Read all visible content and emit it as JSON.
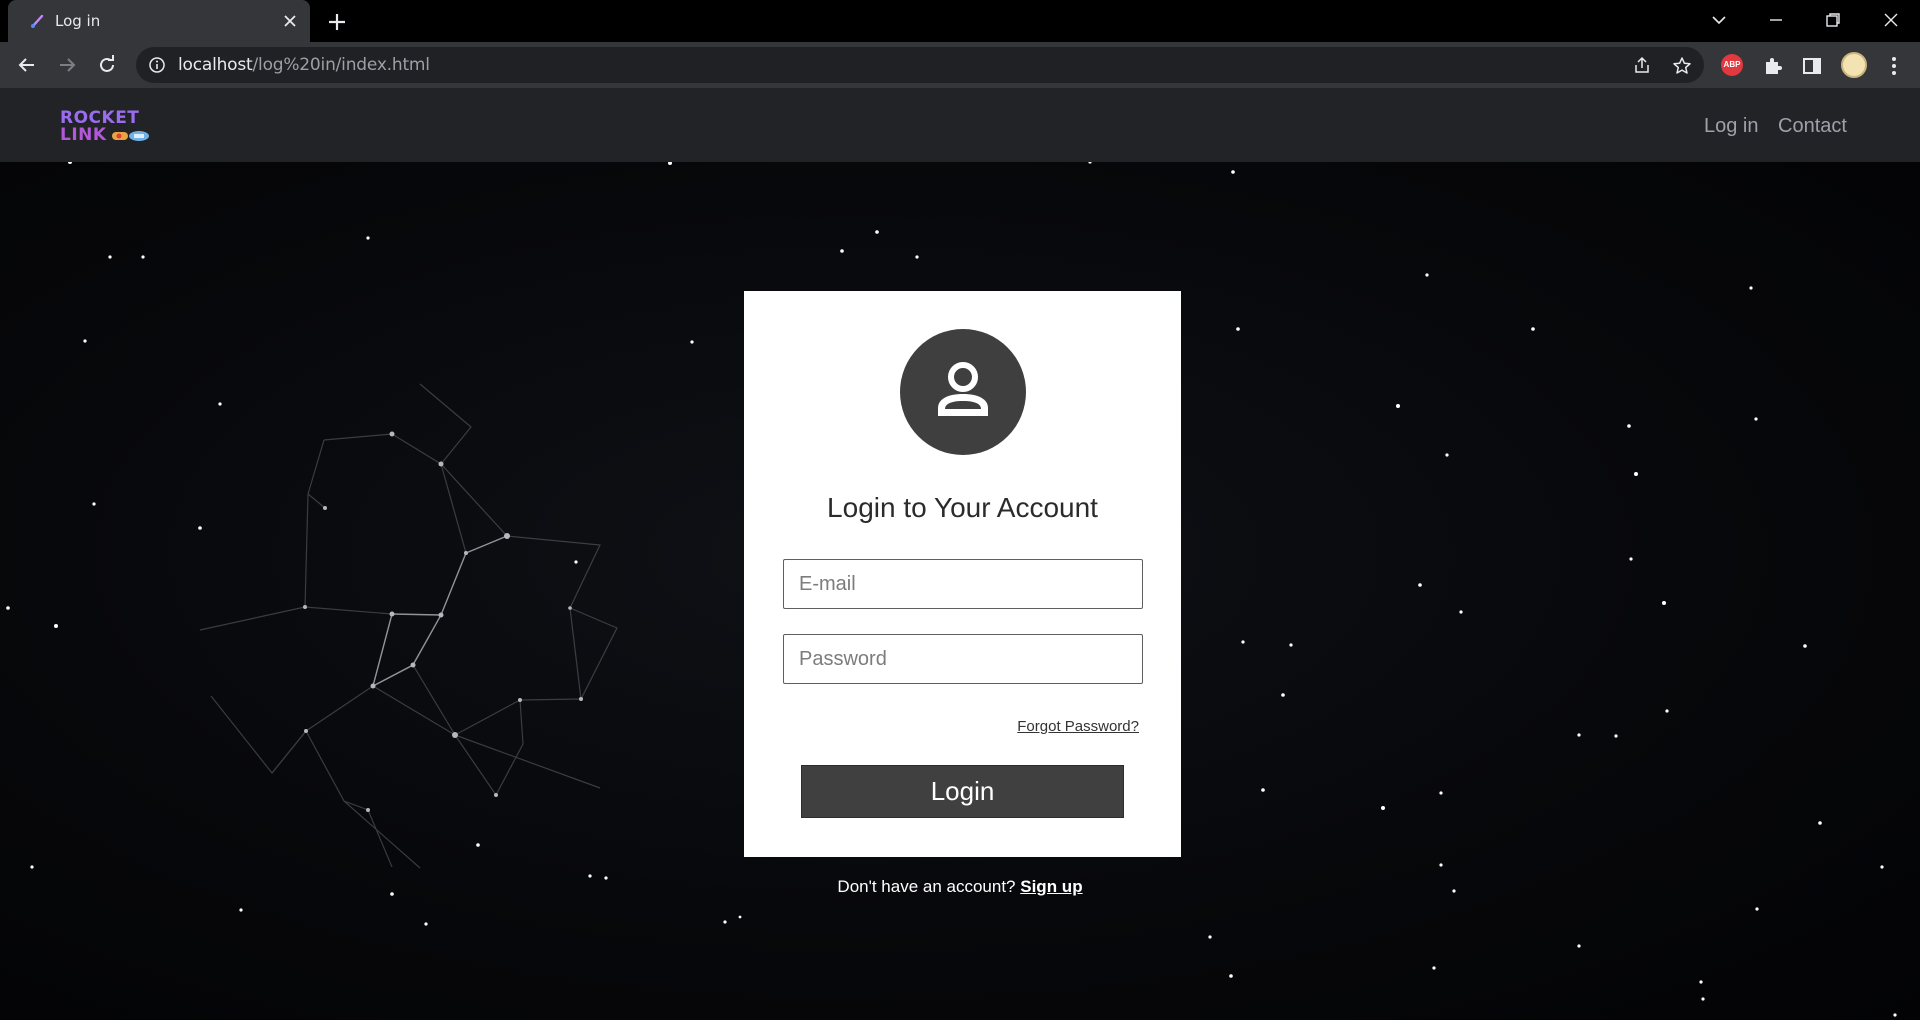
{
  "browser": {
    "tab_title": "Log in",
    "url_host": "localhost",
    "url_path": "/log%20in/index.html",
    "abp_label": "ABP"
  },
  "site": {
    "logo_line1": "ROCKET",
    "logo_line2": "LINK",
    "nav": {
      "login": "Log in",
      "contact": "Contact"
    }
  },
  "login_card": {
    "title": "Login to Your Account",
    "email_placeholder": "E-mail",
    "password_placeholder": "Password",
    "forgot_label": "Forgot Password?",
    "submit_label": "Login"
  },
  "signup": {
    "prompt": "Don't have an account?",
    "link_label": "Sign up"
  },
  "colors": {
    "navbar": "#212327",
    "card": "#ffffff",
    "button": "#404040",
    "avatar": "#3f3f3f",
    "logo_purple": "#9b6cf0"
  },
  "icons": [
    "brush-favicon-icon",
    "close-icon",
    "plus-icon",
    "chevron-down-icon",
    "minimize-icon",
    "restore-icon",
    "back-icon",
    "forward-icon",
    "reload-icon",
    "info-icon",
    "share-icon",
    "star-icon",
    "puzzle-icon",
    "sidebar-icon",
    "kebab-menu-icon",
    "user-icon"
  ]
}
